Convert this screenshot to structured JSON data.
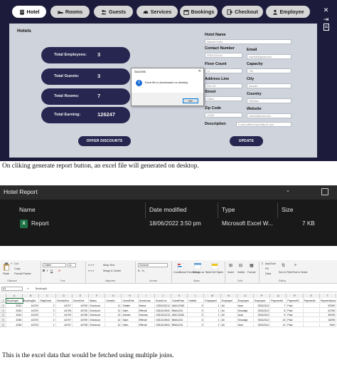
{
  "app": {
    "nav": [
      {
        "label": "Hotel",
        "icon": "building-icon",
        "active": true
      },
      {
        "label": "Rooms",
        "icon": "bed-icon",
        "active": false
      },
      {
        "label": "Guests",
        "icon": "people-icon",
        "active": false
      },
      {
        "label": "Services",
        "icon": "car-icon",
        "active": false
      },
      {
        "label": "Bookings",
        "icon": "calendar-icon",
        "active": false
      },
      {
        "label": "Checkout",
        "icon": "checkout-icon",
        "active": false
      },
      {
        "label": "Employee",
        "icon": "employee-icon",
        "active": false
      }
    ],
    "side_icons": [
      "close-icon",
      "logout-icon",
      "document-icon"
    ],
    "panel_title": "Hotels",
    "stats": [
      {
        "label": "Total Employees:",
        "value": "3"
      },
      {
        "label": "Total Guests:",
        "value": "3"
      },
      {
        "label": "Total Rooms:",
        "value": "7"
      },
      {
        "label": "Total Earning:",
        "value": "126247"
      }
    ],
    "offer_button": "OFFER DISCOUNTS",
    "update_button": "UPDATE",
    "form": {
      "hotel_name": {
        "label": "Hotel Name",
        "value": "Marriott Hotel"
      },
      "contact_number": {
        "label": "Contact Number",
        "value": "03321231241"
      },
      "email": {
        "label": "Email",
        "value": "marriott@gmail.com"
      },
      "floor_count": {
        "label": "Floor Count",
        "value": "14"
      },
      "capacity": {
        "label": "Capacity",
        "value": "700"
      },
      "address_line": {
        "label": "Address Line",
        "value": "Plot 1/3"
      },
      "city": {
        "label": "City",
        "value": "Karachi"
      },
      "street": {
        "label": "Street",
        "value": "Clifton"
      },
      "country": {
        "label": "Country",
        "value": "Pakistan"
      },
      "zip_code": {
        "label": "Zip Code",
        "value": "12345"
      },
      "website": {
        "label": "Website",
        "value": "marriott@hotel.com"
      },
      "description": {
        "label": "Description",
        "value": "It was crafted especially for you"
      }
    },
    "dialog": {
      "title": "Success",
      "message": "Excel file is downloaded on desktop.",
      "ok": "OK"
    }
  },
  "caption1": "On cliking generate report button, an excel file will generated on desktop.",
  "explorer": {
    "title": "Hotel Report",
    "columns": [
      "Name",
      "Date modified",
      "Type",
      "Size"
    ],
    "file": {
      "name": "Report",
      "date": "18/06/2022 3:50 pm",
      "type": "Microsoft Excel W...",
      "size": "7 KB"
    }
  },
  "excel": {
    "font": "Calibri",
    "font_size": "11",
    "number_format": "General",
    "clipboard": {
      "paste": "Paste",
      "cut": "Cut",
      "copy": "Copy",
      "format_painter": "Format Painter"
    },
    "ribbon_items": {
      "wrap": "Wrap Text",
      "merge": "Merge & Center",
      "conditional": "Conditional Formatting",
      "format_table": "Format as Table",
      "cell_styles": "Cell Styles",
      "insert": "Insert",
      "delete": "Delete",
      "format": "Format",
      "autosum": "AutoSum",
      "fill": "Fill",
      "clear": "Clear",
      "sort": "Sort & Filter",
      "find": "Find & Select"
    },
    "groups": [
      "Clipboard",
      "Font",
      "Alignment",
      "Number",
      "Styles",
      "Cells",
      "Editing"
    ],
    "name_box": "A1",
    "formula": "BookingId",
    "column_letters": [
      "A",
      "B",
      "C",
      "D",
      "E",
      "F",
      "G",
      "H",
      "I",
      "J",
      "K",
      "L",
      "M",
      "N",
      "O",
      "P",
      "Q",
      "R",
      "S",
      "T"
    ],
    "headers": [
      "BookingId",
      "BookingDa",
      "StayDurat",
      "CheckInDa",
      "CheckOut",
      "Status",
      "GuestId",
      "GuestFirst",
      "GuestLast",
      "GuestCon",
      "GuestPass",
      "HotelId",
      "EmployeeI",
      "Employee",
      "Employee",
      "Employee",
      "PaymentId",
      "PaymentS",
      "PaymentA",
      "PaymentAmount"
    ],
    "rows": [
      [
        "2032",
        "44729",
        "2",
        "44707",
        "44709",
        "Checkout",
        "11",
        "Shaikh",
        "Moina",
        "0331231211",
        "MAX12345",
        "3",
        "1",
        "Ali",
        "Asar",
        "03312312",
        "7",
        "Paid",
        "",
        "32399"
      ],
      [
        "2033",
        "44729",
        "2",
        "44728",
        "44730",
        "Checkout",
        "11",
        "Saim",
        "Effendi",
        "0331313941",
        "BMA1231",
        "3",
        "1",
        "Ali",
        "Khowaja",
        "03312312",
        "8",
        "Paid",
        "",
        "42750"
      ],
      [
        "2034",
        "44729",
        "7",
        "44729",
        "44736",
        "Checkout",
        "13",
        "Ahmed",
        "Kamran",
        "0331231213",
        "ABC12353",
        "3",
        "1",
        "Ali",
        "Asar",
        "03312312",
        "9",
        "Paid",
        "",
        "28799"
      ],
      [
        "2035",
        "44729",
        "2",
        "44707",
        "44709",
        "Checkout",
        "12",
        "Saim",
        "Effendi",
        "0331313941",
        "BMA1231",
        "3",
        "1",
        "Ali",
        "Khowaja",
        "03312312",
        "10",
        "Paid",
        "",
        "15299"
      ],
      [
        "2036",
        "44729",
        "1",
        "44707",
        "44708",
        "Checkout",
        "12",
        "Saim",
        "Effendi",
        "0331313941",
        "BMA1231",
        "3",
        "1",
        "Ali",
        "Asar",
        "03312312",
        "11",
        "Paid",
        "",
        "7000"
      ]
    ]
  },
  "caption2": "This is the excel data that would be fetched using multiple joins."
}
